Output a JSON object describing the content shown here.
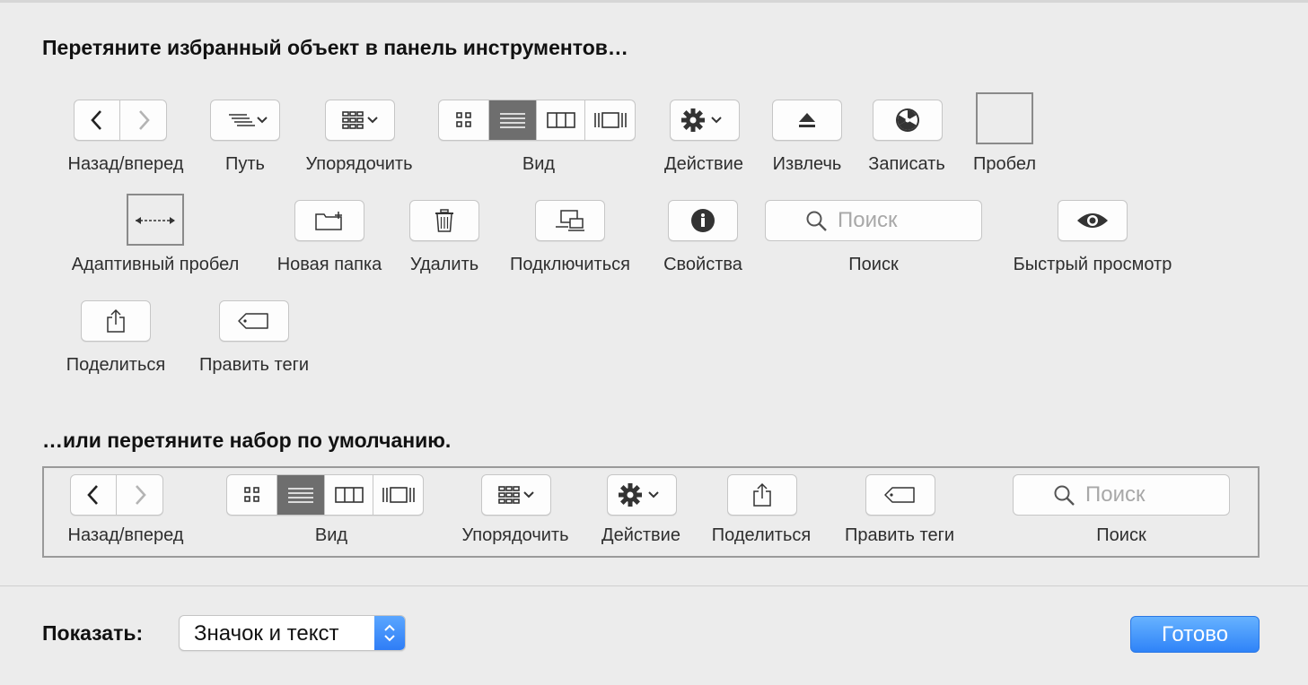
{
  "header": {
    "title": "Перетяните избранный объект в панель инструментов…"
  },
  "items": {
    "back_forward": "Назад/вперед",
    "path": "Путь",
    "arrange": "Упорядочить",
    "view": "Вид",
    "action": "Действие",
    "eject": "Извлечь",
    "burn": "Записать",
    "space": "Пробел",
    "flexible_space": "Адаптивный пробел",
    "new_folder": "Новая папка",
    "delete": "Удалить",
    "connect": "Подключиться",
    "info": "Свойства",
    "search": "Поиск",
    "search_placeholder": "Поиск",
    "quick_look": "Быстрый просмотр",
    "share": "Поделиться",
    "edit_tags": "Править теги"
  },
  "default_set": {
    "title": "…или перетяните набор по умолчанию.",
    "back_forward": "Назад/вперед",
    "view": "Вид",
    "arrange": "Упорядочить",
    "action": "Действие",
    "share": "Поделиться",
    "edit_tags": "Править теги",
    "search": "Поиск",
    "search_placeholder": "Поиск"
  },
  "footer": {
    "show_label": "Показать:",
    "show_value": "Значок и текст",
    "done_label": "Готово"
  },
  "colors": {
    "background": "#ececec",
    "accent": "#2f83f8",
    "selected_segment": "#6e6e6e"
  }
}
